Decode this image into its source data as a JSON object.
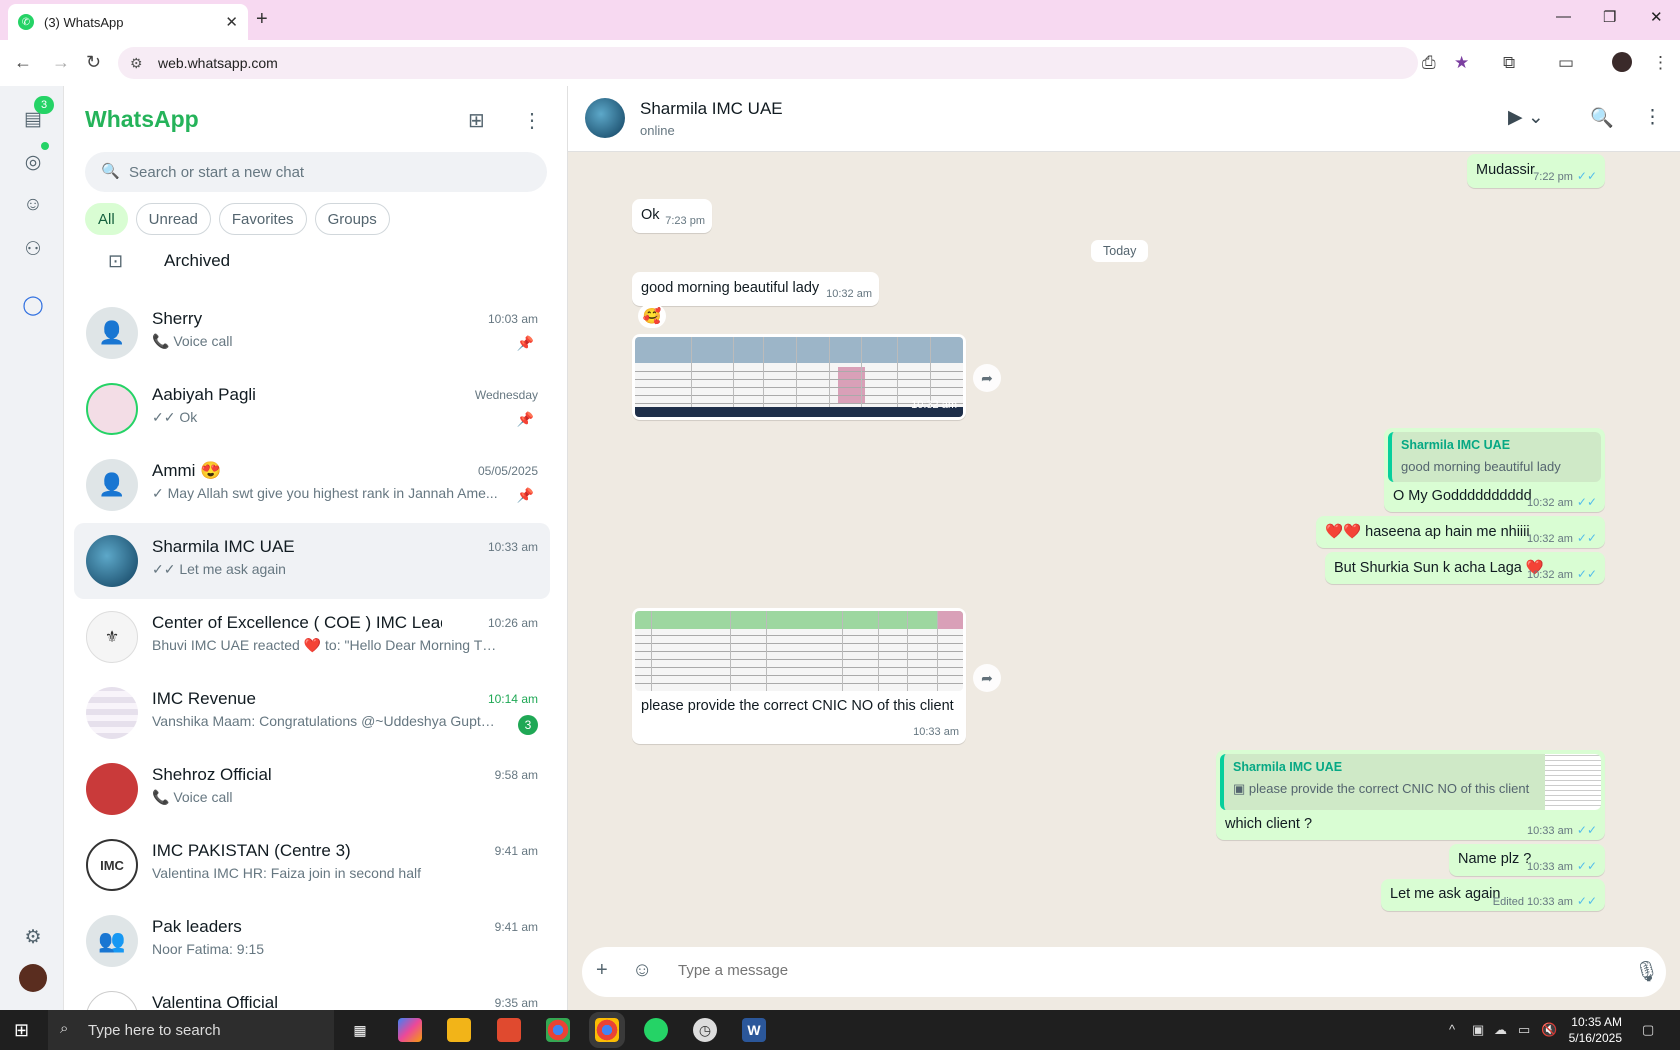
{
  "browser": {
    "tab_title": "(3) WhatsApp",
    "tab_close": "✕",
    "new_tab": "+",
    "url": "web.whatsapp.com",
    "window_min": "—",
    "window_max": "❐",
    "window_close": "✕"
  },
  "rail": {
    "badge": "3"
  },
  "sidebar": {
    "brand": "WhatsApp",
    "search_placeholder": "Search or start a new chat",
    "filters": [
      "All",
      "Unread",
      "Favorites",
      "Groups"
    ],
    "archived_label": "Archived"
  },
  "chats": [
    {
      "name": "Sherry",
      "time": "10:03 am",
      "preview": "📞 Voice call",
      "pinned": true
    },
    {
      "name": "Aabiyah Pagli",
      "time": "Wednesday",
      "preview": "✓✓ Ok",
      "pinned": true
    },
    {
      "name": "Ammi 😍",
      "time": "05/05/2025",
      "preview": "✓ May Allah swt give you highest rank in Jannah  Ame...",
      "pinned": true
    },
    {
      "name": "Sharmila IMC UAE",
      "time": "10:33 am",
      "preview": "✓✓ Let me ask again"
    },
    {
      "name": "Center of Excellence ( COE ) IMC Leads",
      "time": "10:26 am",
      "preview": "Bhuvi IMC UAE reacted ❤️ to: \"Hello Dear  Morning  Than..."
    },
    {
      "name": "IMC Revenue",
      "time": "10:14 am",
      "preview": "Vanshika Maam: Congratulations @~Uddeshya Gupta ...",
      "unread": "3"
    },
    {
      "name": "Shehroz Official",
      "time": "9:58 am",
      "preview": "📞 Voice call"
    },
    {
      "name": "IMC PAKISTAN (Centre 3)",
      "time": "9:41 am",
      "preview": "Valentina IMC HR: Faiza join in second half"
    },
    {
      "name": "Pak leaders",
      "time": "9:41 am",
      "preview": "Noor Fatima: 9:15"
    },
    {
      "name": "Valentina Official",
      "time": "9:35 am",
      "preview": ""
    }
  ],
  "chat": {
    "title": "Sharmila IMC UAE",
    "status": "online",
    "date_divider": "Today",
    "messages": {
      "m1_text": "Mudassir",
      "m1_time": "7:22 pm",
      "m2_text": "Ok",
      "m2_time": "7:23 pm",
      "m3_text": "good morning beautiful lady",
      "m3_time": "10:32 am",
      "m3_reaction": "🥰",
      "m4_time": "10:32 am",
      "m5_quote_name": "Sharmila IMC UAE",
      "m5_quote_text": "good morning beautiful lady",
      "m5_text": "O My Godddddddddd",
      "m5_time": "10:32 am",
      "m6_text": "❤️❤️ haseena ap hain me nhiiii",
      "m6_time": "10:32 am",
      "m7_text": "But Shurkia Sun k acha Laga ❤️",
      "m7_time": "10:32 am",
      "m8_text": "please provide the correct CNIC NO of this client",
      "m8_time": "10:33 am",
      "m9_quote_name": "Sharmila IMC UAE",
      "m9_quote_text": "please provide the correct CNIC NO of this client",
      "m9_text": "which client ?",
      "m9_time": "10:33 am",
      "m10_text": "Name plz ?",
      "m10_time": "10:33 am",
      "m11_text": "Let me ask again",
      "m11_edited": "Edited",
      "m11_time": "10:33 am"
    },
    "composer_placeholder": "Type a message"
  },
  "taskbar": {
    "search_placeholder": "Type here to search",
    "time": "10:35 AM",
    "date": "5/16/2025"
  },
  "colors": {
    "brand_green": "#25b35a",
    "outgoing_bubble": "#d9fdd3",
    "read_tick": "#53bdeb",
    "chat_bg": "#efeae2"
  }
}
